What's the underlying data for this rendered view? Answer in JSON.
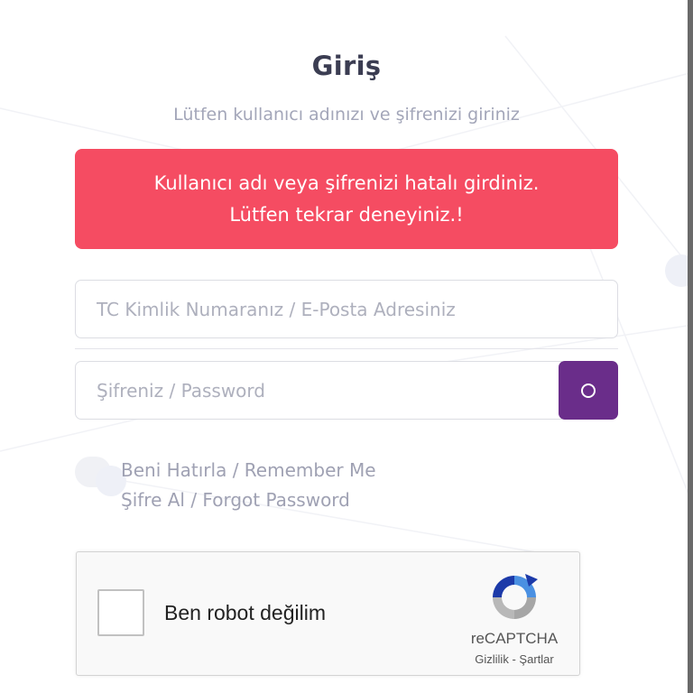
{
  "page": {
    "title": "Giriş",
    "subtitle": "Lütfen kullanıcı adınızı ve şifrenizi giriniz"
  },
  "alert": {
    "line1": "Kullanıcı adı veya şifrenizi hatalı girdiniz.",
    "line2": "Lütfen tekrar deneyiniz.!",
    "color": "#f54c62"
  },
  "form": {
    "username": {
      "value": "",
      "placeholder": "TC Kimlik Numaranız / E-Posta Adresiniz"
    },
    "password": {
      "value": "",
      "placeholder": "Şifreniz / Password"
    },
    "toggle_icon": "eye-icon",
    "remember_label": "Beni Hatırla / Remember Me",
    "remember_checked": false,
    "forgot_label": "Şifre Al / Forgot Password",
    "accent_color": "#6a2d8a"
  },
  "recaptcha": {
    "label": "Ben robot değilim",
    "brand": "reCAPTCHA",
    "privacy": "Gizlilik",
    "separator": "-",
    "terms": "Şartlar",
    "checked": false
  }
}
